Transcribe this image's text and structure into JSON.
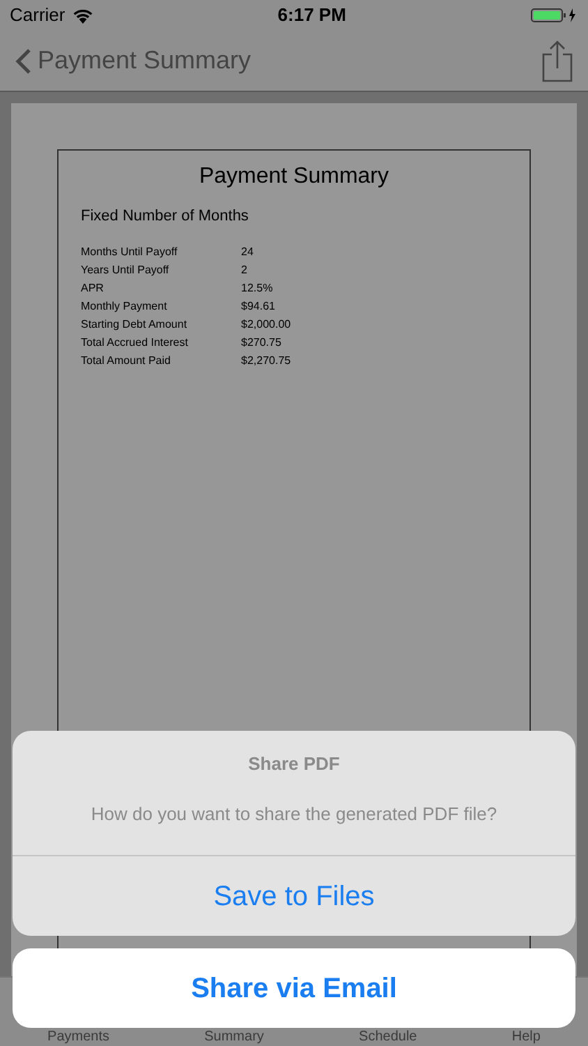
{
  "status_bar": {
    "carrier": "Carrier",
    "time": "6:17 PM"
  },
  "nav_bar": {
    "title": "Payment Summary"
  },
  "document": {
    "title": "Payment Summary",
    "subtitle": "Fixed Number of Months",
    "rows": [
      {
        "label": "Months Until Payoff",
        "value": "24"
      },
      {
        "label": "Years Until Payoff",
        "value": "2"
      },
      {
        "label": "APR",
        "value": "12.5%"
      },
      {
        "label": "Monthly Payment",
        "value": "$94.61"
      },
      {
        "label": "Starting Debt Amount",
        "value": "$2,000.00"
      },
      {
        "label": "Total Accrued Interest",
        "value": "$270.75"
      },
      {
        "label": "Total Amount Paid",
        "value": "$2,270.75"
      }
    ]
  },
  "tab_bar": {
    "items": [
      {
        "label": "Payments"
      },
      {
        "label": "Summary"
      },
      {
        "label": "Schedule"
      },
      {
        "label": "Help"
      }
    ]
  },
  "action_sheet": {
    "title": "Share PDF",
    "message": "How do you want to share the generated PDF file?",
    "actions": [
      {
        "label": "Save to Files"
      }
    ],
    "cancel": {
      "label": "Share via Email"
    }
  }
}
